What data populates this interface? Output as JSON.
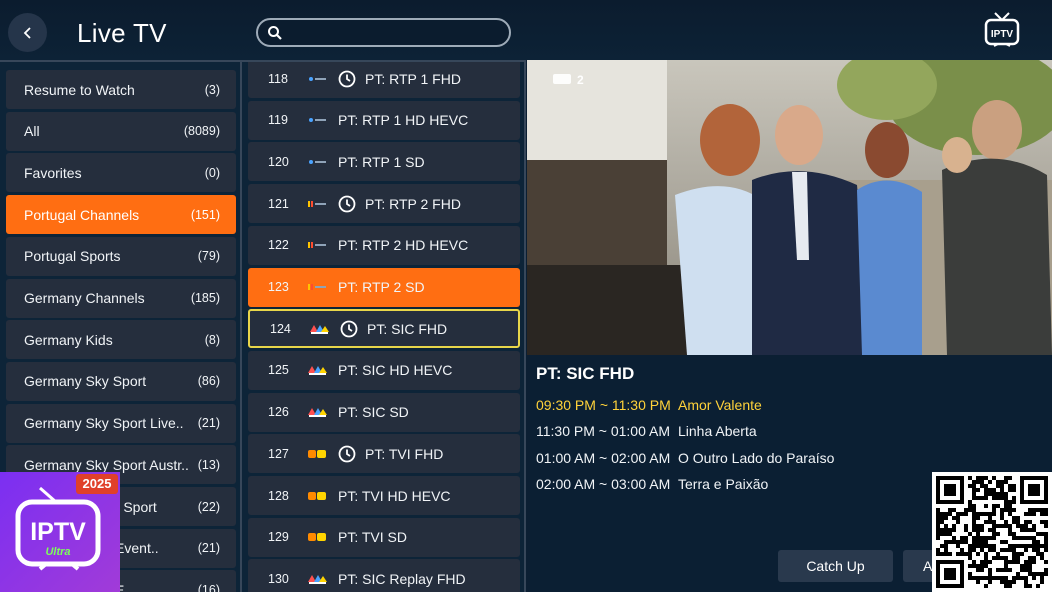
{
  "header": {
    "title": "Live TV",
    "search_placeholder": "",
    "search_value": "",
    "icons": [
      "back-arrow-icon",
      "search-icon",
      "iptv-tv-icon"
    ]
  },
  "categories": [
    {
      "label": "Resume to Watch",
      "count": "(3)"
    },
    {
      "label": "All",
      "count": "(8089)"
    },
    {
      "label": "Favorites",
      "count": "(0)"
    },
    {
      "label": "Portugal Channels",
      "count": "(151)",
      "active": true
    },
    {
      "label": "Portugal Sports",
      "count": "(79)"
    },
    {
      "label": "Germany Channels",
      "count": "(185)"
    },
    {
      "label": "Germany Kids",
      "count": "(8)"
    },
    {
      "label": "Germany Sky Sport",
      "count": "(86)"
    },
    {
      "label": "Germany Sky Sport Live..",
      "count": "(21)"
    },
    {
      "label": "Germany Sky Sport Austr..",
      "count": "(13)"
    },
    {
      "label": "Germany Tenta Sport",
      "count": "(22)"
    },
    {
      "label": "Germany Live Event..",
      "count": "(21)"
    },
    {
      "label": "Germany Live E..",
      "count": "(16)"
    }
  ],
  "channels": [
    {
      "num": "118",
      "name": "PT: RTP 1 FHD",
      "logo": "rtp1",
      "clock": true
    },
    {
      "num": "119",
      "name": "PT: RTP 1 HD HEVC",
      "logo": "rtp1",
      "clock": false
    },
    {
      "num": "120",
      "name": "PT: RTP 1 SD",
      "logo": "rtp1",
      "clock": false
    },
    {
      "num": "121",
      "name": "PT: RTP 2 FHD",
      "logo": "rtp2",
      "clock": true
    },
    {
      "num": "122",
      "name": "PT: RTP 2 HD HEVC",
      "logo": "rtp2",
      "clock": false
    },
    {
      "num": "123",
      "name": "PT: RTP 2 SD",
      "logo": "rtp2",
      "clock": false,
      "active": true
    },
    {
      "num": "124",
      "name": "PT: SIC FHD",
      "logo": "sic",
      "clock": true,
      "focused": true
    },
    {
      "num": "125",
      "name": "PT: SIC HD HEVC",
      "logo": "sic",
      "clock": false
    },
    {
      "num": "126",
      "name": "PT: SIC SD",
      "logo": "sic",
      "clock": false
    },
    {
      "num": "127",
      "name": "PT: TVI FHD",
      "logo": "tvi",
      "clock": true
    },
    {
      "num": "128",
      "name": "PT: TVI HD HEVC",
      "logo": "tvi",
      "clock": false
    },
    {
      "num": "129",
      "name": "PT: TVI SD",
      "logo": "tvi",
      "clock": false
    },
    {
      "num": "130",
      "name": "PT: SIC Replay FHD",
      "logo": "sicr",
      "clock": false
    }
  ],
  "preview": {
    "channel_title": "PT: SIC FHD",
    "watermark": "2"
  },
  "epg": [
    {
      "time": "09:30 PM ~ 11:30 PM",
      "title": "Amor Valente",
      "current": true
    },
    {
      "time": "11:30 PM ~ 01:00 AM",
      "title": "Linha Aberta"
    },
    {
      "time": "01:00 AM ~ 02:00 AM",
      "title": "O Outro Lado do Paraíso"
    },
    {
      "time": "02:00 AM ~ 03:00 AM",
      "title": "Terra e Paixão"
    }
  ],
  "buttons": {
    "catch_up": "Catch Up",
    "second": "A"
  },
  "badge": {
    "year": "2025",
    "brand": "IPTV",
    "sub": "Ultra"
  },
  "colors": {
    "accent": "#ff6e12",
    "focus": "#e8d64a",
    "current_epg": "#ffd23a",
    "background": "#0b1f33",
    "item": "#252e3d"
  }
}
